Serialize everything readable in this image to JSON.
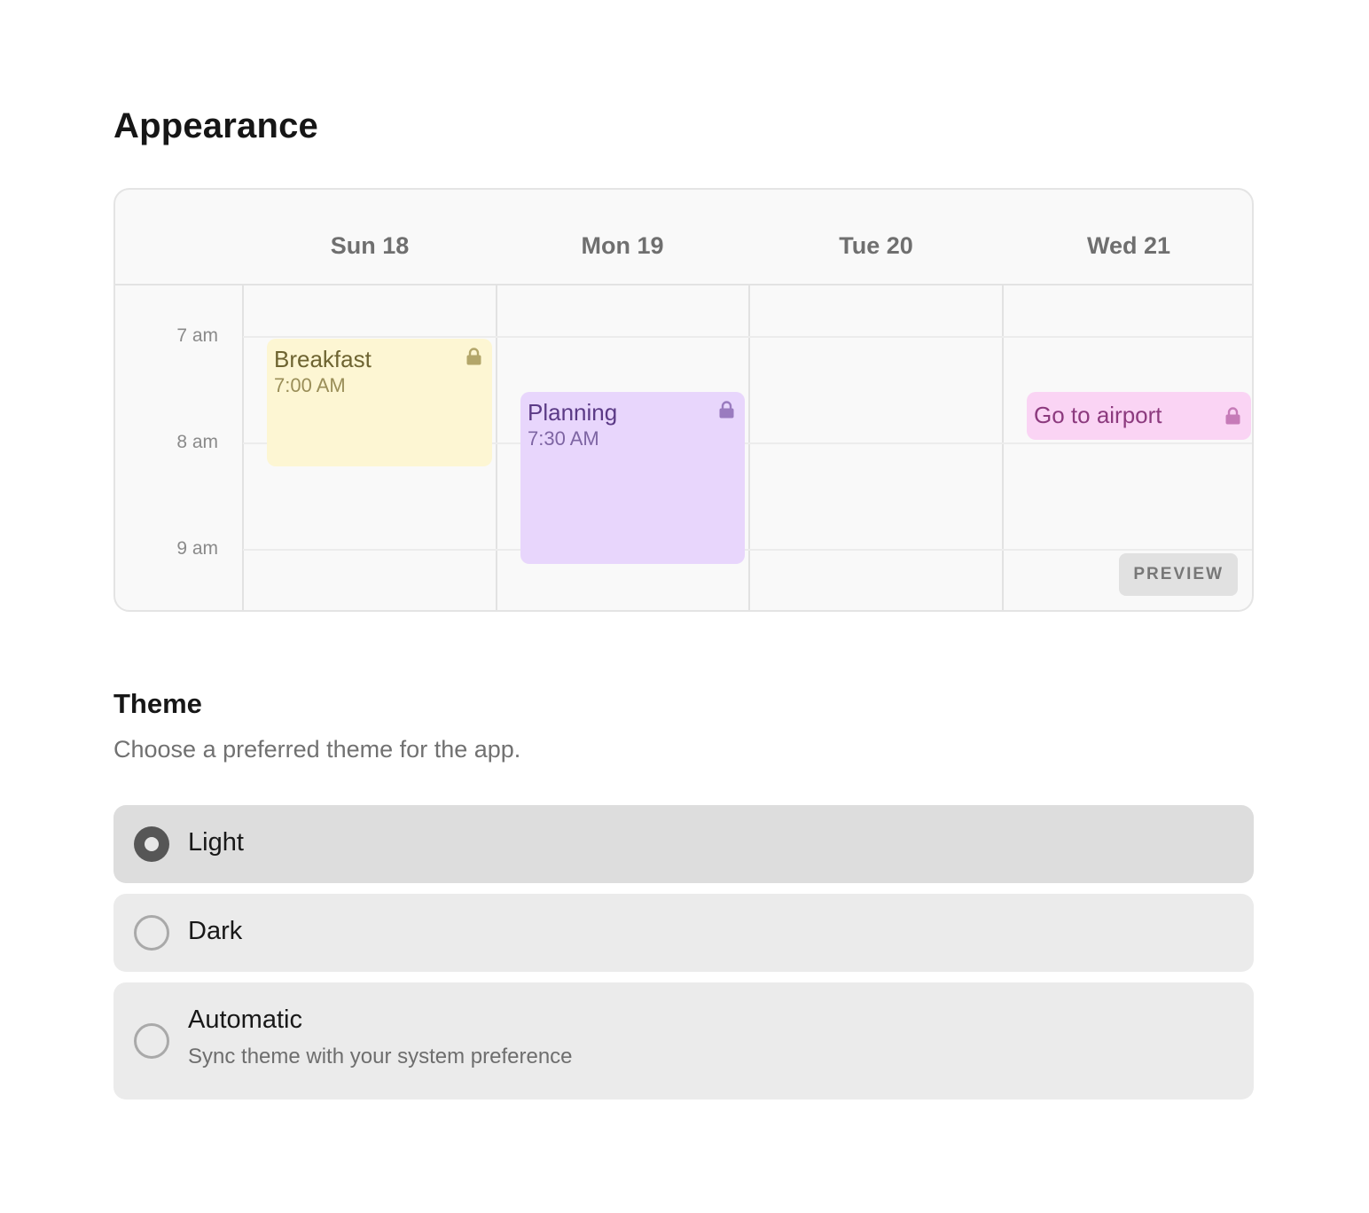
{
  "page": {
    "title": "Appearance"
  },
  "calendar": {
    "days": [
      "Sun 18",
      "Mon 19",
      "Tue 20",
      "Wed 21"
    ],
    "times": [
      "7 am",
      "8 am",
      "9 am"
    ],
    "events": [
      {
        "title": "Breakfast",
        "time": "7:00 AM",
        "locked": true,
        "color": "#fdf6d3"
      },
      {
        "title": "Planning",
        "time": "7:30 AM",
        "locked": true,
        "color": "#e8d6fc"
      },
      {
        "title": "Go to airport",
        "locked": true,
        "color": "#fad4f4"
      }
    ],
    "preview_label": "PREVIEW"
  },
  "theme": {
    "title": "Theme",
    "subtitle": "Choose a preferred theme for the app.",
    "options": [
      {
        "label": "Light",
        "selected": true
      },
      {
        "label": "Dark",
        "selected": false
      },
      {
        "label": "Automatic",
        "description": "Sync theme with your system preference",
        "selected": false
      }
    ]
  }
}
